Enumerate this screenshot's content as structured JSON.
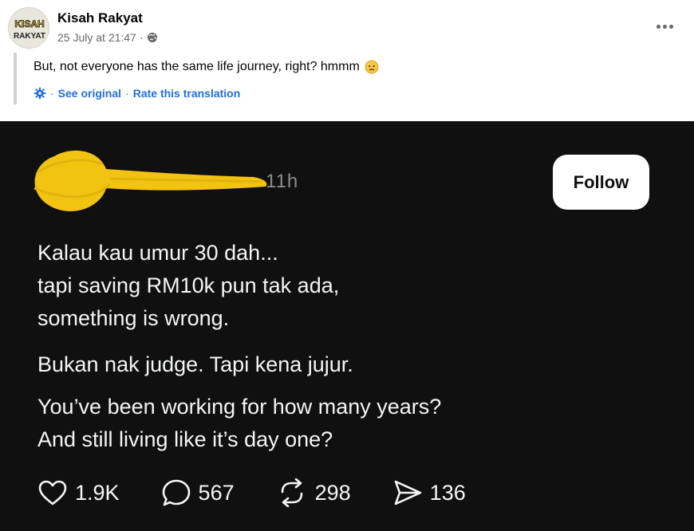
{
  "post": {
    "author": "Kisah Rakyat",
    "avatar_text_top": "KISAH",
    "avatar_text_bottom": "RAKYAT",
    "timestamp": "25 July at 21:47",
    "separator": "·",
    "audience_icon": "globe-icon",
    "more_icon": "more-options-icon",
    "caption": "But, not everyone has the same life journey, right? hmmm",
    "caption_emoji": "frowning-face-icon",
    "see_original": "See original",
    "rate_translation": "Rate this translation",
    "dot": "·"
  },
  "embedded": {
    "time_ago": "11h",
    "follow_label": "Follow",
    "paragraphs": [
      [
        "Kalau kau umur 30 dah...",
        "tapi saving RM10k pun tak ada,",
        "something is wrong."
      ],
      [
        "Bukan nak judge. Tapi kena jujur."
      ],
      [
        "You’ve been working for how many years?",
        "And still living like it’s day one?"
      ]
    ],
    "actions": {
      "likes": "1.9K",
      "replies": "567",
      "reposts": "298",
      "shares": "136"
    }
  },
  "colors": {
    "fb_link": "#216fdb",
    "dark_bg": "#101010",
    "scribble": "#f3c311",
    "text_light": "#f3f5f7"
  }
}
